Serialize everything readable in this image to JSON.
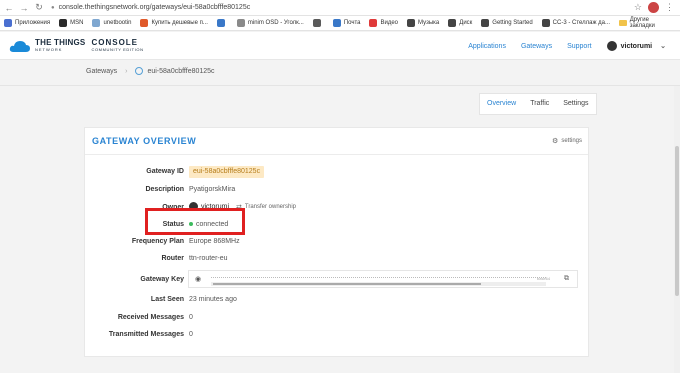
{
  "browser": {
    "url": "console.thethingsnetwork.org/gateways/eui-58a0cbfffe80125c",
    "bookmarks": [
      {
        "label": "Приложения",
        "color": "#4a6fd0"
      },
      {
        "label": "MSN",
        "color": "#2a2a2a"
      },
      {
        "label": "unetbootin",
        "color": "#7fa7d0"
      },
      {
        "label": "Купить дешевые п...",
        "color": "#e05a2a"
      },
      {
        "label": "",
        "color": "#3a78c8"
      },
      {
        "label": "minim OSD - Уголк...",
        "color": "#8a8a8a"
      },
      {
        "label": "",
        "color": "#5a5a5a"
      },
      {
        "label": "Почта",
        "color": "#3a78c8"
      },
      {
        "label": "Видео",
        "color": "#e03a3a"
      },
      {
        "label": "Музыка",
        "color": "#444"
      },
      {
        "label": "Диск",
        "color": "#444"
      },
      {
        "label": "Getting Started",
        "color": "#444"
      },
      {
        "label": "CC-3 - Стеллаж да...",
        "color": "#444"
      }
    ],
    "other_bookmarks": "Другие закладки"
  },
  "header": {
    "logo_main": "THE THINGS",
    "logo_sub": "NETWORK",
    "console_main": "CONSOLE",
    "console_sub": "COMMUNITY EDITION",
    "nav": [
      "Applications",
      "Gateways",
      "Support"
    ],
    "username": "victorumi"
  },
  "breadcrumb": {
    "root": "Gateways",
    "current": "eui-58a0cbfffe80125c"
  },
  "tabs": [
    "Overview",
    "Traffic",
    "Settings"
  ],
  "card": {
    "title": "GATEWAY OVERVIEW",
    "settings_label": "settings",
    "fields": {
      "gateway_id_label": "Gateway ID",
      "gateway_id": "eui-58a0cbfffe80125c",
      "description_label": "Description",
      "description": "PyatigorskMira",
      "owner_label": "Owner",
      "owner": "victorumi",
      "transfer_label": "Transfer ownership",
      "status_label": "Status",
      "status": "connected",
      "frequency_label": "Frequency Plan",
      "frequency": "Europe 868MHz",
      "router_label": "Router",
      "router": "ttn-router-eu",
      "key_label": "Gateway Key",
      "key_base": "base64",
      "last_seen_label": "Last Seen",
      "last_seen": "23 minutes ago",
      "received_label": "Received Messages",
      "received": "0",
      "transmitted_label": "Transmitted Messages",
      "transmitted": "0"
    }
  },
  "colors": {
    "accent": "#2a84d2",
    "status_ok": "#3dbb5e",
    "highlight": "#e02020"
  }
}
